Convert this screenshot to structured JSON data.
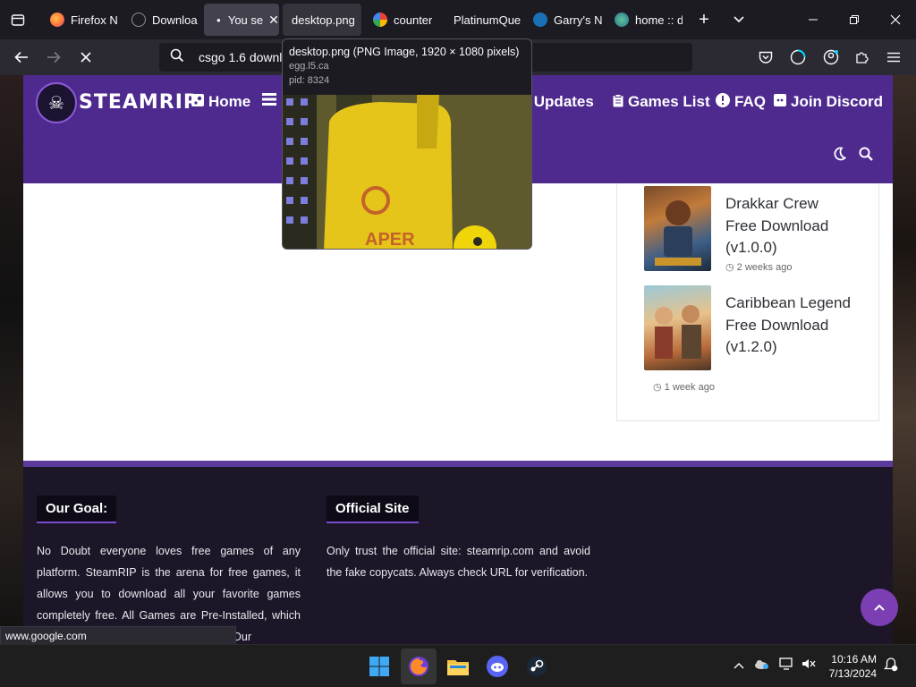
{
  "browser": {
    "tabs": [
      {
        "title": "Firefox N",
        "favicon_color": "#ff7139"
      },
      {
        "title": "Downloa",
        "favicon_color": "#8f8f9d"
      },
      {
        "title": "You se",
        "favicon_color": "#fbfbfe",
        "close": "✕"
      },
      {
        "title": "desktop.png",
        "favicon_color": "transparent"
      },
      {
        "title": "counter",
        "favicon_color": "#4285f4"
      },
      {
        "title": "PlatinumQue",
        "favicon_color": "transparent"
      },
      {
        "title": "Garry's N",
        "favicon_color": "#1b6fb5"
      },
      {
        "title": "home :: d",
        "favicon_color": "#3a8f6a"
      }
    ],
    "new_tab": "+",
    "url_value": "csgo 1.6 downl",
    "status_url": "www.google.com"
  },
  "tab_preview": {
    "title": "desktop.png (PNG Image, 1920 × 1080 pixels)",
    "host": "egg.l5.ca",
    "pid": "pid: 8324"
  },
  "site": {
    "logo_text": "STEAMRIP",
    "menu": {
      "home": "Home",
      "updates": "nt Updates",
      "games_list": "Games List",
      "faq": "FAQ",
      "discord": "Join Discord"
    },
    "posts": [
      {
        "title": "Drakkar Crew Free Download (v1.0.0)",
        "date": "2 weeks ago"
      },
      {
        "title": "Caribbean Legend Free Download (v1.2.0)",
        "date": "1 week ago"
      }
    ],
    "footer": {
      "goal_title": "Our Goal:",
      "goal_text": "No Doubt everyone loves free games of any platform. SteamRIP is the arena for free games, it allows you to download all your favorite games completely free. All Games are Pre-Installed, which means you don't have to install games. Our",
      "official_title": "Official Site",
      "official_text": "Only trust the official site: steamrip.com and avoid the fake copycats. Always check URL for verification."
    }
  },
  "taskbar": {
    "time": "10:16 AM",
    "date": "7/13/2024"
  },
  "colors": {
    "header_purple": "#4e2a8e",
    "footer_dark": "#1c1628",
    "accent": "#7b3fb3"
  }
}
